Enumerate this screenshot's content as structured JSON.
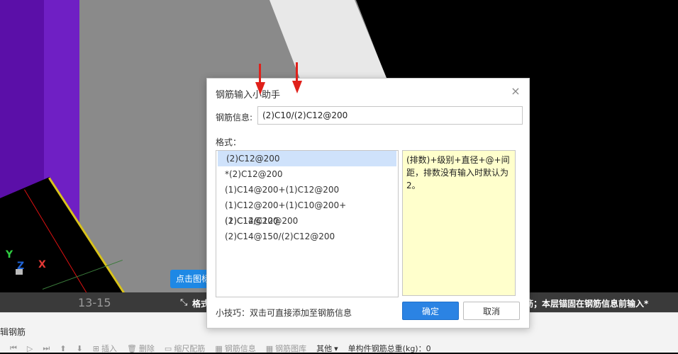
{
  "viewport": {
    "axis": {
      "y": "Y",
      "x": "X",
      "z": "Z"
    },
    "floor_label": "13-15",
    "tooltip": "点击图标",
    "status_left": "格式",
    "status_right": "筋；本层锚固在钢筋信息前输入*"
  },
  "dialog": {
    "title": "钢筋输入小助手",
    "close_icon": "×",
    "info_label": "钢筋信息:",
    "info_value": "(2)C10/(2)C12@200",
    "format_label": "格式：",
    "formats": [
      "(2)C12@200",
      "*(2)C12@200",
      "(1)C14@200+(1)C12@200",
      "(1)C12@200+(1)C10@200+(1)C12@200",
      "(2)C14/C12@200",
      "(2)C14@150/(2)C12@200"
    ],
    "selected_index": 0,
    "description": "(排数)+级别+直径+@+间距，排数没有输入时默认为2。",
    "tip": "小技巧：双击可直接添加至钢筋信息",
    "ok": "确定",
    "cancel": "取消"
  },
  "bottom_panel": {
    "title": "辑钢筋",
    "toolbar": {
      "insert": "插入",
      "delete": "删除",
      "scale_rebar": "缩尺配筋",
      "rebar_info": "钢筋信息",
      "rebar_diagram": "钢筋图库",
      "other": "其他",
      "total_weight": "单构件钢筋总重(kg)：0"
    }
  },
  "colors": {
    "accent": "#2b83e3",
    "arrow": "#e0201a",
    "desc_bg": "#ffffcc"
  }
}
